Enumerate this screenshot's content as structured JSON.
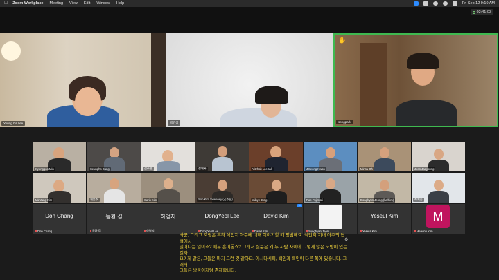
{
  "menubar": {
    "app": "Zoom Workplace",
    "items": [
      "Meeting",
      "View",
      "Edit",
      "Window",
      "Help"
    ],
    "clock": "Fri Sep 12  9:10 AM"
  },
  "timer": "02:41:03",
  "featured": [
    {
      "name": "Young Gil Lee"
    },
    {
      "name": "곽권성"
    },
    {
      "name": "songpark"
    }
  ],
  "gallery": [
    [
      "Kyunggoo Min",
      "Seungho Bang",
      "김주현",
      "설재록",
      "Yitzhak LeeSak",
      "JiSeong Kwon",
      "Minsu Oh",
      "Jeon Jaeyoung"
    ],
    [
      "MinJung Kim",
      "채문주",
      "Caris Kim",
      "Soo Kim Sweeney (김수환)",
      "mihye Jung",
      "Rae Fujimori",
      "Donghyun Jeong (he/him)",
      "최지승"
    ],
    [
      {
        "big": "Don Chang",
        "name": "Don Chang"
      },
      {
        "big": "동환 김",
        "name": "동환 김"
      },
      {
        "big": "하경지",
        "name": "하경지"
      },
      {
        "big": "DongYeol Lee",
        "name": "DongYeol Lee"
      },
      {
        "big": "David Kim",
        "name": "David Kim"
      },
      {
        "big": "",
        "name": "Sunghyun Jeon"
      },
      {
        "big": "Yeseul Kim",
        "name": "Yeseul Kim"
      },
      {
        "big": "",
        "name": "Meadou Kim"
      }
    ]
  ],
  "avatar_letter": "M",
  "more_label": "···",
  "caption": [
    "바꾼, 그리고 오랑은 흑하 석인지 아주에 내해 이야기할 때 평범해요. 석인지 지내 아주의 연설에서",
    "일어나는 일이죠? 매우 흥미롭죠? 그래서 질문은 왜 두 사람 사이에 그렇게 많은 모방이 있는 걸까",
    "요? 제 말은, 그들은 마치 그런 것 같아요. 아시다시피, 백인과 흑인이 다른 쪽에 있습니다. 그래서",
    "그들은 쌍둥이처럼 존재합니다."
  ],
  "colors": {
    "active_speaker": "#3fb950",
    "caption": "#f2d43d",
    "avatar": "#c0145e"
  }
}
